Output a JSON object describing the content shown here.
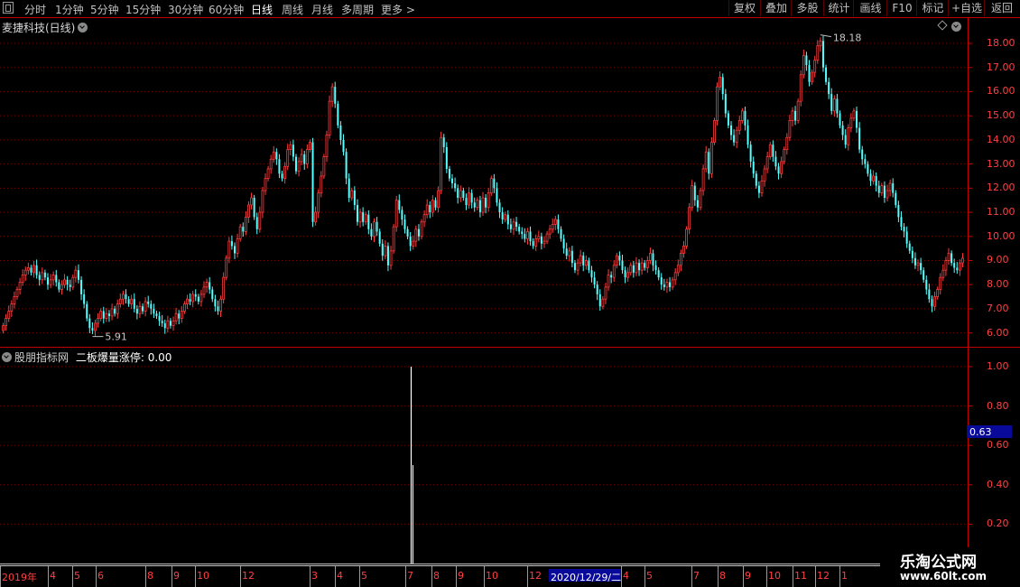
{
  "toolbar": {
    "periods": [
      "分时",
      "1分钟",
      "5分钟",
      "15分钟",
      "30分钟",
      "60分钟",
      "日线",
      "周线",
      "月线",
      "多周期",
      "更多 >"
    ],
    "active_period": "日线",
    "buttons": [
      "复权",
      "叠加",
      "多股",
      "统计",
      "画线",
      "F10",
      "标记",
      "+自选",
      "返回"
    ]
  },
  "main_chart": {
    "title": "麦捷科技(日线)",
    "price_ticks": [
      "18.00",
      "17.00",
      "16.00",
      "15.00",
      "14.00",
      "13.00",
      "12.00",
      "11.00",
      "10.00",
      "9.00",
      "8.00",
      "7.00",
      "6.00"
    ],
    "high_label": "18.18",
    "low_label": "5.91",
    "colors": {
      "up": "#ff3c3c",
      "down": "#54ffff",
      "grid": "#7a0000",
      "axis": "#c00000"
    }
  },
  "indicator": {
    "title_prefix": "股朋指标网",
    "title_name": "二板爆量涨停",
    "title_value": "0.00",
    "ticks": [
      "1.00",
      "0.80",
      "0.60",
      "0.40",
      "0.20"
    ],
    "cursor_value": "0.63"
  },
  "date_axis": {
    "labels": [
      "2019年",
      "4",
      "5",
      "6",
      "8",
      "9",
      "10",
      "12",
      "3",
      "4",
      "5",
      "7",
      "8",
      "9",
      "10",
      "12",
      "4",
      "5",
      "7",
      "8",
      "9",
      "10",
      "11",
      "12",
      "1"
    ],
    "cursor_date": "2020/12/29/二"
  },
  "watermark": {
    "name": "乐淘公式网",
    "url": "www.60lt.com"
  },
  "chart_data": {
    "type": "candlestick",
    "ylim": [
      5.5,
      18.6
    ],
    "closes": [
      6.3,
      6.6,
      6.9,
      7.2,
      7.5,
      7.8,
      8.1,
      8.4,
      8.6,
      8.7,
      8.5,
      8.8,
      8.4,
      8.2,
      8.5,
      8.3,
      8.0,
      8.2,
      8.4,
      8.1,
      7.8,
      8.0,
      8.2,
      8.0,
      7.9,
      8.3,
      8.6,
      8.2,
      7.6,
      7.2,
      6.6,
      6.2,
      6.1,
      6.4,
      6.6,
      6.9,
      6.6,
      6.8,
      6.7,
      7.0,
      6.8,
      7.2,
      7.4,
      7.6,
      7.4,
      7.2,
      7.4,
      7.0,
      6.8,
      7.1,
      6.9,
      7.3,
      7.2,
      7.0,
      6.8,
      6.7,
      6.5,
      6.4,
      6.2,
      6.5,
      6.3,
      6.5,
      6.8,
      6.6,
      6.9,
      7.2,
      7.4,
      7.3,
      7.6,
      7.5,
      7.3,
      7.6,
      7.9,
      8.1,
      7.8,
      7.4,
      7.1,
      6.9,
      7.4,
      8.3,
      9.1,
      9.8,
      9.6,
      9.3,
      9.9,
      10.4,
      10.2,
      10.8,
      11.3,
      11.6,
      10.8,
      10.3,
      11.0,
      11.9,
      12.4,
      12.8,
      13.2,
      13.5,
      13.2,
      12.6,
      12.4,
      12.9,
      13.6,
      13.8,
      13.3,
      12.7,
      13.1,
      13.4,
      13.0,
      13.6,
      13.9,
      10.6,
      11.0,
      11.8,
      12.5,
      13.3,
      14.2,
      15.6,
      16.2,
      15.5,
      14.6,
      14.0,
      13.5,
      12.4,
      11.6,
      11.9,
      11.3,
      10.6,
      11.0,
      10.6,
      10.9,
      10.3,
      10.0,
      10.6,
      10.2,
      9.7,
      9.2,
      9.6,
      8.8,
      9.4,
      10.4,
      11.5,
      11.1,
      10.7,
      10.3,
      10.0,
      9.6,
      9.8,
      10.3,
      10.0,
      10.6,
      10.9,
      11.3,
      11.0,
      11.5,
      11.2,
      11.9,
      14.1,
      13.7,
      12.8,
      12.4,
      12.2,
      12.0,
      11.6,
      11.9,
      11.6,
      11.3,
      11.8,
      11.4,
      11.2,
      11.5,
      11.0,
      11.6,
      11.2,
      11.8,
      12.4,
      12.0,
      11.4,
      11.0,
      10.7,
      10.9,
      10.5,
      10.3,
      10.6,
      10.4,
      10.2,
      10.1,
      9.9,
      10.2,
      9.8,
      9.6,
      9.9,
      10.0,
      9.7,
      9.8,
      10.1,
      10.3,
      10.5,
      10.7,
      10.3,
      9.9,
      9.5,
      9.2,
      9.4,
      8.9,
      8.6,
      8.9,
      9.2,
      8.8,
      9.0,
      8.6,
      8.3,
      8.0,
      7.6,
      7.1,
      7.4,
      7.9,
      8.4,
      8.3,
      8.8,
      9.2,
      9.0,
      8.6,
      8.3,
      8.5,
      8.8,
      8.5,
      8.9,
      8.6,
      8.9,
      8.7,
      9.0,
      9.3,
      8.8,
      8.6,
      8.3,
      8.0,
      7.9,
      8.1,
      7.9,
      8.2,
      8.5,
      8.8,
      9.3,
      9.6,
      10.3,
      11.2,
      12.1,
      11.5,
      11.2,
      11.9,
      12.8,
      13.5,
      12.6,
      13.9,
      14.8,
      16.2,
      16.6,
      15.9,
      15.1,
      14.6,
      14.2,
      13.9,
      14.4,
      14.8,
      15.2,
      14.6,
      13.8,
      13.1,
      12.6,
      12.1,
      11.8,
      12.3,
      12.8,
      13.3,
      13.8,
      13.3,
      12.9,
      12.6,
      13.1,
      13.6,
      14.1,
      14.8,
      15.2,
      14.8,
      15.6,
      16.7,
      17.5,
      17.1,
      16.4,
      16.8,
      17.3,
      17.9,
      18.1,
      17.0,
      16.4,
      15.9,
      15.2,
      15.7,
      15.1,
      14.6,
      14.2,
      13.8,
      14.5,
      14.9,
      15.2,
      14.5,
      13.6,
      13.2,
      13.0,
      12.6,
      12.3,
      12.5,
      12.1,
      11.8,
      12.1,
      11.6,
      11.9,
      12.2,
      11.8,
      11.3,
      10.8,
      10.4,
      10.2,
      9.7,
      9.4,
      9.1,
      8.8,
      8.9,
      8.6,
      8.2,
      7.8,
      7.4,
      7.1,
      7.5,
      7.8,
      8.3,
      8.6,
      9.0,
      9.3,
      8.9,
      8.7,
      8.6,
      8.9,
      9.1
    ]
  }
}
